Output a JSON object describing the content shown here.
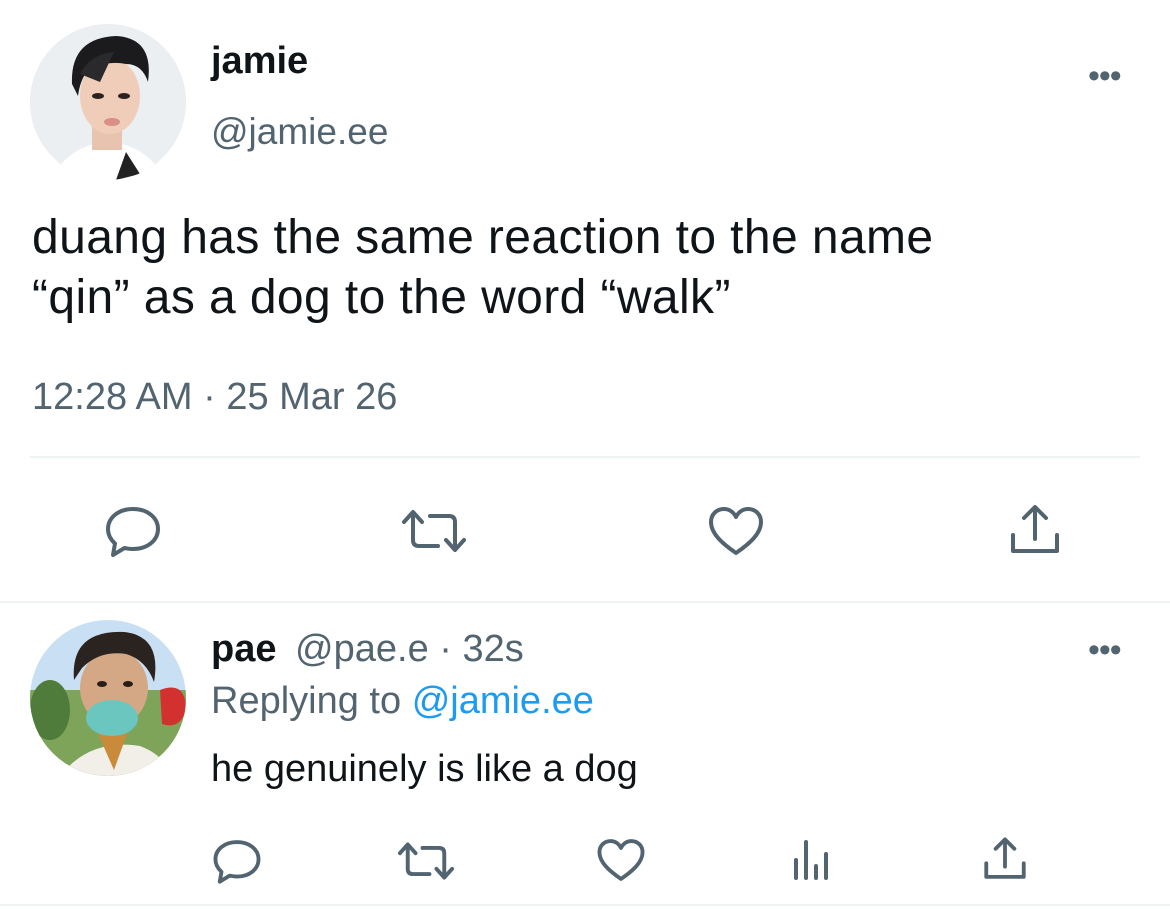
{
  "main_tweet": {
    "author": {
      "display_name": "jamie",
      "handle": "@jamie.ee"
    },
    "text_line1": "duang has the same reaction to the name",
    "text_line2": "“qin” as a dog to the word “walk”",
    "timestamp": "12:28 AM · 25 Mar 26",
    "more_label": "•••",
    "actions": [
      "reply-icon",
      "retweet-icon",
      "like-icon",
      "share-icon"
    ]
  },
  "reply": {
    "author": {
      "display_name": "pae",
      "handle": "@pae.e",
      "separator": "·",
      "time": "32s"
    },
    "replying_prefix": "Replying to",
    "replying_handle": "@jamie.ee",
    "text": "he genuinely is like a dog",
    "more_label": "•••",
    "actions": [
      "reply-icon",
      "retweet-icon",
      "like-icon",
      "views-icon",
      "share-icon"
    ]
  },
  "colors": {
    "text": "#0f1419",
    "muted": "#536471",
    "link": "#1d9bf0",
    "divider": "#eff3f4"
  }
}
